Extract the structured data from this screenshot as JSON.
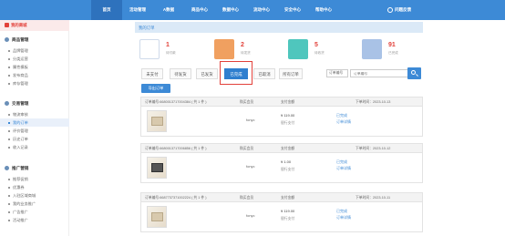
{
  "nav": {
    "items": [
      "首页",
      "活动管理",
      "A数据",
      "商品中心",
      "数据中心",
      "流动中心",
      "安全中心",
      "帮助中心"
    ],
    "active_index": 0,
    "user": "问题反馈"
  },
  "sidebar": {
    "top_label": "我的商城",
    "sections": [
      {
        "title": "商品管理",
        "items": [
          "品牌管理",
          "分类运营",
          "属性模板",
          "发布商品",
          "库存管理"
        ]
      },
      {
        "title": "交易管理",
        "items": [
          "物流审核",
          "我的订单",
          "评价管理",
          "历史订单",
          "收入记录"
        ]
      },
      {
        "title": "推广营销",
        "items": [
          "推荐促销",
          "优惠券",
          "入驻区域商城",
          "我的业务推广",
          "广告推广",
          "活动推广"
        ]
      }
    ],
    "active_item": "我的订单"
  },
  "page": {
    "breadcrumb": "我的订单"
  },
  "stats": [
    {
      "value": "1",
      "label": "待付款",
      "color": "#ffffff"
    },
    {
      "value": "2",
      "label": "待发货",
      "color": "#f0a060"
    },
    {
      "value": "5",
      "label": "待收货",
      "color": "#4fc6bd"
    },
    {
      "value": "91",
      "label": "已完成",
      "color": "#a9c2e6"
    }
  ],
  "tabs": [
    "未支付",
    "待发货",
    "已发货",
    "已完成",
    "已取消",
    "所有订单"
  ],
  "active_tab": "已完成",
  "filter": {
    "select": "订单编号",
    "placeholder": "订单编号"
  },
  "batch_button": "导出订单",
  "order_columns": {
    "buyer": "购买会员",
    "amount": "支付金额",
    "time_label": "下单时间"
  },
  "orders": [
    {
      "number": "订单编号:6680013717004384 ( 共 1 件 )",
      "time": "2023-10-13",
      "buyer": "fonyc",
      "amount": "¥ 119.00",
      "pay": "银行支付",
      "status": "已完成",
      "detail": "订单详情",
      "image": "box-light"
    },
    {
      "number": "订单编号:6680013717006856 ( 共 1 件 )",
      "time": "2023-10-12",
      "buyer": "fonyc",
      "amount": "¥ 1.00",
      "pay": "银行支付",
      "status": "已完成",
      "detail": "订单详情",
      "image": "box-dark"
    },
    {
      "number": "订单编号:6687737371002224 ( 共 1 件 )",
      "time": "2023-10-11",
      "buyer": "fonyc",
      "amount": "¥ 119.00",
      "pay": "银行支付",
      "status": "已完成",
      "detail": "订单详情",
      "image": "box-light"
    }
  ]
}
